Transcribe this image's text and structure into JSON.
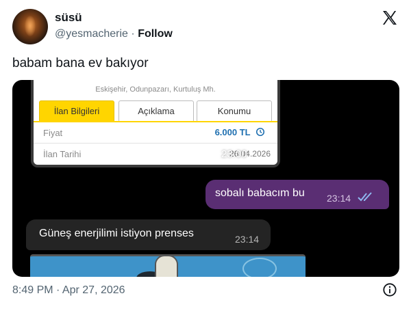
{
  "author": {
    "name": "süsü",
    "handle": "@yesmacherie",
    "separator": "·",
    "follow_label": "Follow"
  },
  "tweet": {
    "text": "babam bana ev bakıyor",
    "timestamp": "8:49 PM · Apr 27, 2026"
  },
  "screenshot": {
    "listing": {
      "address": "Eskişehir, Odunpazarı, Kurtuluş Mh.",
      "tabs": [
        {
          "label": "İlan Bilgileri",
          "active": true
        },
        {
          "label": "Açıklama",
          "active": false
        },
        {
          "label": "Konumu",
          "active": false
        }
      ],
      "price_label": "Fiyat",
      "price_value": "6.000 TL",
      "date_label": "İlan Tarihi",
      "date_value": "26.04.2026",
      "message_time": "23:00"
    },
    "outgoing_message": {
      "text": "sobalı babacım bu",
      "time": "23:14"
    },
    "incoming_message": {
      "text": "Güneş enerjilimi istiyon prenses",
      "time": "23:14"
    }
  },
  "colors": {
    "tab_active": "#ffd500",
    "price": "#1e6fb0",
    "outgoing_bubble": "#5a2e73",
    "incoming_bubble": "#242424",
    "read_ticks": "#8fb8f0"
  },
  "icons": [
    "x-logo-icon",
    "history-icon",
    "double-check-icon",
    "info-icon"
  ]
}
